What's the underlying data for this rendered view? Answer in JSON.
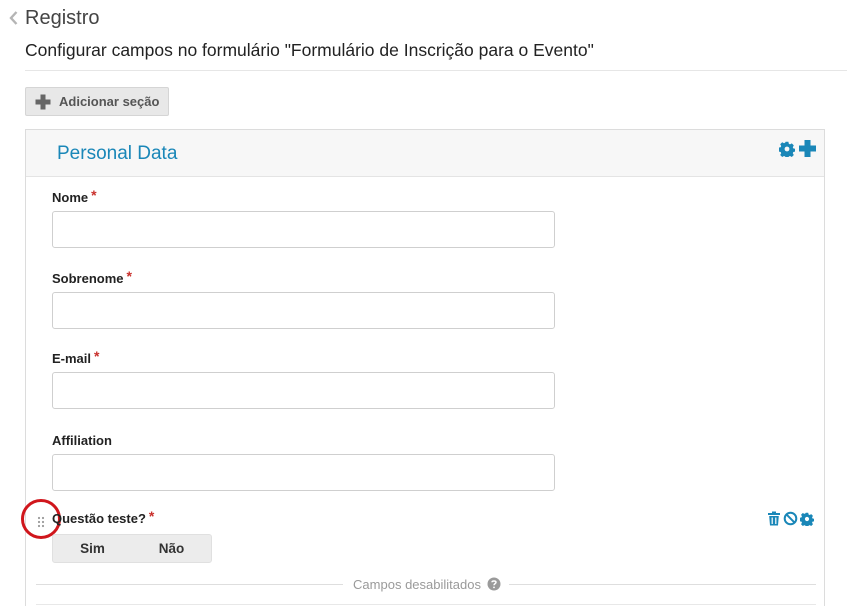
{
  "header": {
    "title": "Registro",
    "subtitle": "Configurar campos no formulário \"Formulário de Inscrição para o Evento\""
  },
  "toolbar": {
    "add_section_label": "Adicionar seção"
  },
  "section": {
    "title": "Personal Data",
    "fields": [
      {
        "label": "Nome",
        "required": "*",
        "value": ""
      },
      {
        "label": "Sobrenome",
        "required": "*",
        "value": ""
      },
      {
        "label": "E-mail",
        "required": "*",
        "value": ""
      },
      {
        "label": "Affiliation",
        "value": ""
      }
    ],
    "question": {
      "label": "Questão teste?",
      "required": "*",
      "options": [
        "Sim",
        "Não"
      ]
    },
    "disabled_fields_label": "Campos desabilitados"
  },
  "icons": {
    "back": "chevron-left-icon",
    "add": "plus-icon",
    "settings": "gear-icon",
    "delete": "trash-icon",
    "disable": "ban-icon",
    "drag": "drag-handle-icon",
    "help": "question-circle-icon"
  },
  "colors": {
    "accent": "#1a87b8",
    "required": "#c9302c",
    "highlight": "#d0161c",
    "button_bg": "#e8e8e8"
  }
}
